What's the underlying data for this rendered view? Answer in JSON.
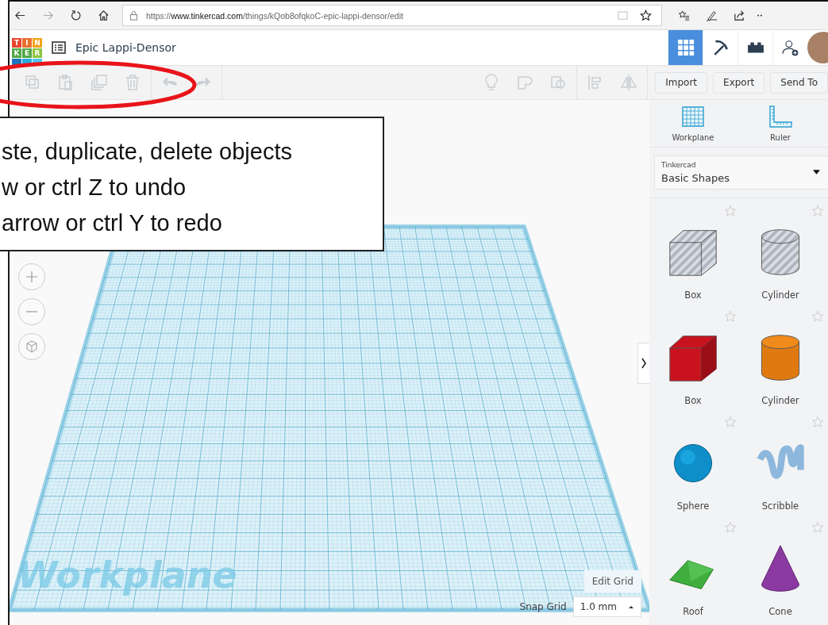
{
  "browser": {
    "url": "https://**www.tinkercad.com**/things/kQob8ofqkoC-epic-lappi-densor/edit"
  },
  "logo": {
    "letters": [
      "T",
      "I",
      "N",
      "K",
      "E",
      "R"
    ]
  },
  "project_title": "Epic Lappi-Densor",
  "nav_buttons": [
    {
      "kind": "grid",
      "selected": true
    },
    {
      "kind": "pickaxe",
      "selected": false
    },
    {
      "kind": "brick",
      "selected": false
    },
    {
      "kind": "add-user",
      "selected": false
    }
  ],
  "toolbar": {
    "edit_tools": [
      {
        "kind": "copy",
        "disabled": true
      },
      {
        "kind": "paste",
        "disabled": true
      },
      {
        "kind": "duplicate",
        "disabled": true
      },
      {
        "kind": "delete",
        "disabled": true
      },
      {
        "kind": "undo",
        "disabled": true
      },
      {
        "kind": "redo",
        "disabled": true
      }
    ],
    "view_tools": [
      {
        "kind": "bulb",
        "disabled": true
      },
      {
        "kind": "group",
        "disabled": true
      },
      {
        "kind": "ungroup",
        "disabled": true
      },
      {
        "kind": "align",
        "disabled": true
      },
      {
        "kind": "mirror",
        "disabled": true
      }
    ],
    "actions": [
      "Import",
      "Export",
      "Send To"
    ]
  },
  "view_controls": [
    {
      "kind": "zoom-in"
    },
    {
      "kind": "zoom-out"
    },
    {
      "kind": "cube"
    }
  ],
  "canvas": {
    "workplane_label": "Workplane",
    "edit_grid": "Edit Grid",
    "snap_grid": {
      "label": "Snap Grid",
      "value": "1.0 mm"
    }
  },
  "panel": {
    "tools": [
      {
        "kind": "workplane",
        "label": "Workplane"
      },
      {
        "kind": "ruler",
        "label": "Ruler"
      }
    ],
    "library": {
      "source": "Tinkercad",
      "value": "Basic Shapes"
    },
    "shapes": [
      {
        "kind": "box-hole",
        "label": "Box"
      },
      {
        "kind": "cylinder-hole",
        "label": "Cylinder"
      },
      {
        "kind": "box",
        "label": "Box"
      },
      {
        "kind": "cylinder",
        "label": "Cylinder"
      },
      {
        "kind": "sphere",
        "label": "Sphere"
      },
      {
        "kind": "scribble",
        "label": "Scribble"
      },
      {
        "kind": "roof",
        "label": "Roof"
      },
      {
        "kind": "cone",
        "label": "Cone"
      }
    ]
  },
  "annotation": {
    "lines": [
      "ste, duplicate, delete objects",
      "w or ctrl Z to undo",
      "arrow or ctrl Y to redo"
    ]
  }
}
